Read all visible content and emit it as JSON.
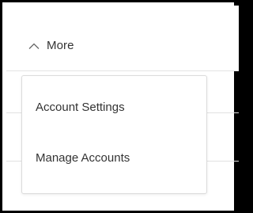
{
  "more_menu": {
    "toggle_label": "More",
    "toggle_icon": "chevron-up-icon",
    "items": [
      {
        "label": "Account Settings"
      },
      {
        "label": "Manage Accounts"
      }
    ]
  },
  "colors": {
    "text": "#333333",
    "border": "#dcdcdc",
    "frame": "#000000",
    "background": "#ffffff"
  }
}
